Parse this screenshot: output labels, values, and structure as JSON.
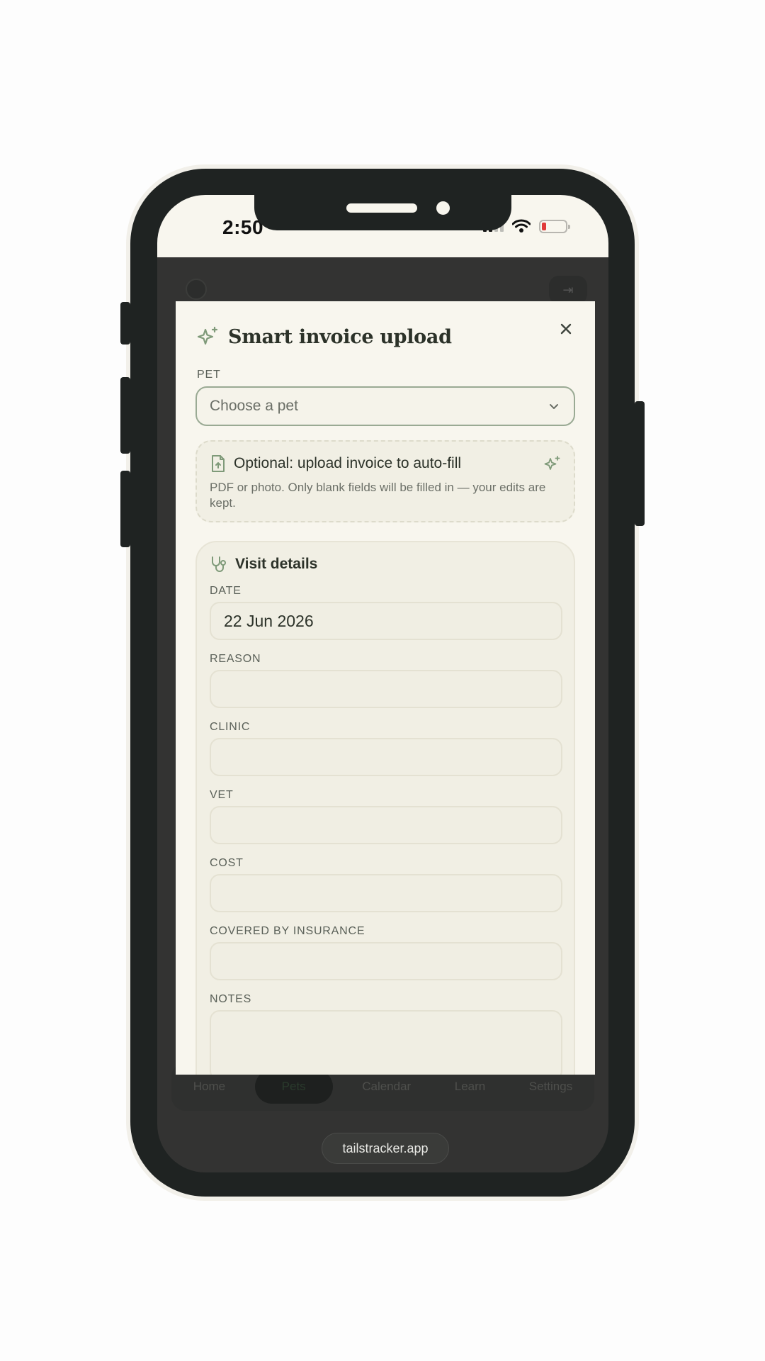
{
  "status_bar": {
    "time": "2:50"
  },
  "background_app": {
    "nav": [
      {
        "label": "Home",
        "active": false
      },
      {
        "label": "Pets",
        "active": true
      },
      {
        "label": "Calendar",
        "active": false
      },
      {
        "label": "Learn",
        "active": false
      },
      {
        "label": "Settings",
        "active": false
      }
    ],
    "url": "tailstracker.app"
  },
  "modal": {
    "title": "Smart invoice upload",
    "close_icon": "close-icon",
    "pet": {
      "label": "PET",
      "placeholder": "Choose a pet"
    },
    "upload": {
      "title": "Optional: upload invoice to auto-fill",
      "description": "PDF or photo. Only blank fields will be filled in — your edits are kept."
    },
    "visit": {
      "title": "Visit details",
      "fields": {
        "date": {
          "label": "DATE",
          "value": "22 Jun 2026"
        },
        "reason": {
          "label": "REASON",
          "value": ""
        },
        "clinic": {
          "label": "CLINIC",
          "value": ""
        },
        "vet": {
          "label": "VET",
          "value": ""
        },
        "cost": {
          "label": "COST",
          "value": ""
        },
        "insurance": {
          "label": "COVERED BY INSURANCE",
          "value": ""
        },
        "notes": {
          "label": "NOTES",
          "value": ""
        }
      }
    }
  },
  "colors": {
    "accent": "#7f9a79",
    "modal_bg": "#f8f6ee",
    "phone_frame": "#1f2322",
    "battery_low": "#e03a3a"
  }
}
